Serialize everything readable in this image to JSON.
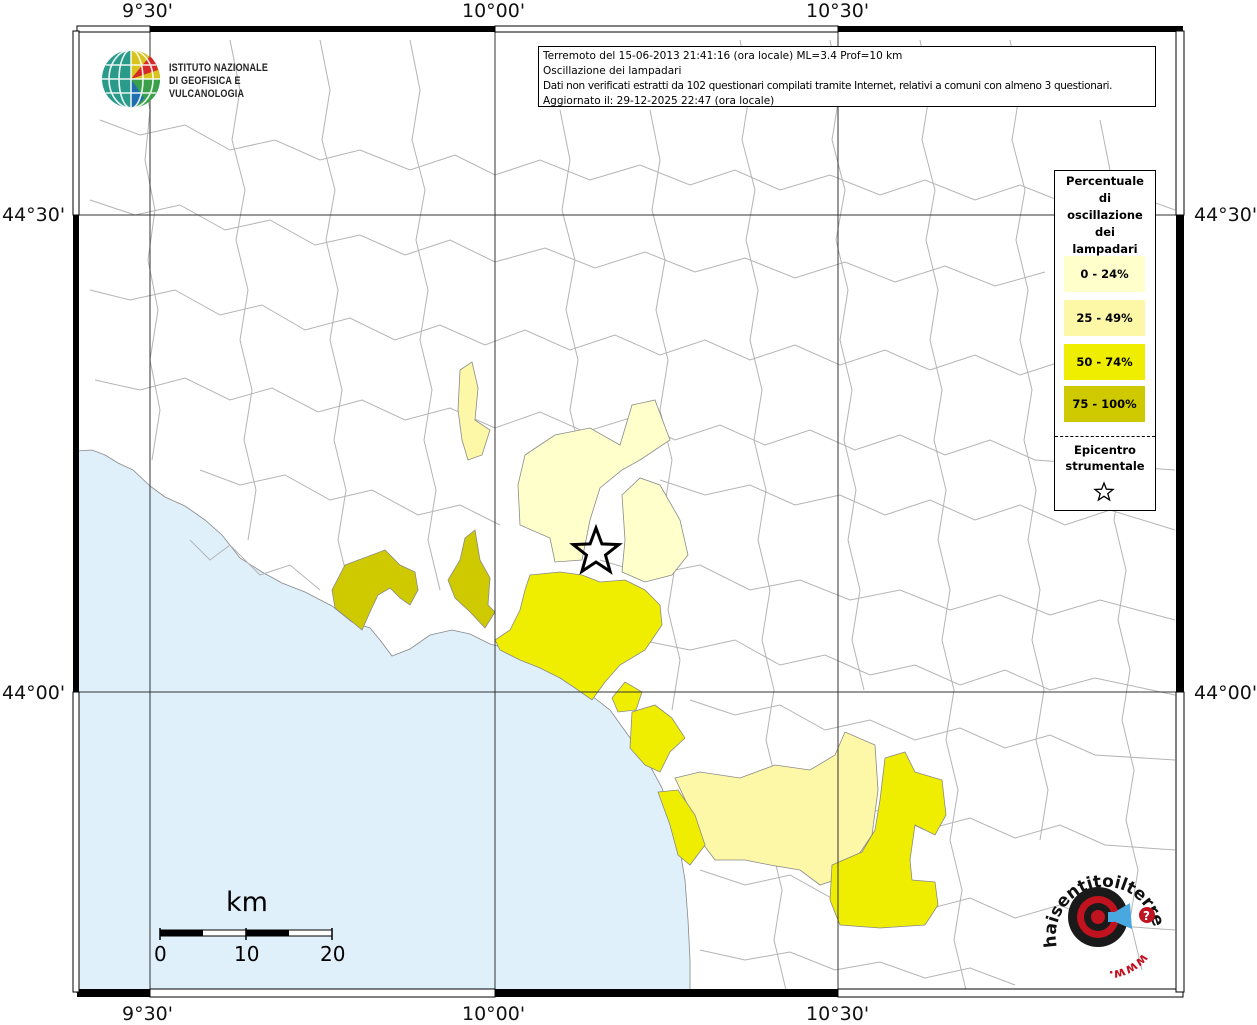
{
  "map": {
    "lon_labels": [
      "9°30'",
      "10°00'",
      "10°30'"
    ],
    "lat_labels": [
      "44°30'",
      "44°00'"
    ],
    "colors": {
      "sea": "#dff0fb",
      "land": "#ffffff",
      "borders": "#b4b4b4",
      "grid": "#333333",
      "class_0_24": "#ffffcc",
      "class_25_49": "#fdf7a8",
      "class_50_74": "#f0ee00",
      "class_75_100": "#cfc900"
    }
  },
  "info": {
    "line1": "Terremoto del 15-06-2013 21:41:16 (ora locale) ML=3.4 Prof=10 km",
    "line2": "Oscillazione dei lampadari",
    "line3": "Dati non verificati estratti da 102 questionari compilati tramite Internet, relativi a comuni con almeno 3 questionari.",
    "line4": "Aggiornato il: 29-12-2025 22:47 (ora locale)"
  },
  "logo": {
    "line1": "ISTITUTO NAZIONALE",
    "line2": "DI GEOFISICA E VULCANOLOGIA"
  },
  "legend": {
    "title_lines": [
      "Percentuale",
      "di",
      "oscillazione",
      "dei",
      "lampadari"
    ],
    "items": [
      {
        "label": "0 - 24%",
        "color": "#ffffcc"
      },
      {
        "label": "25 - 49%",
        "color": "#fdf7a8"
      },
      {
        "label": "50 - 74%",
        "color": "#f0ee00"
      },
      {
        "label": "75 - 100%",
        "color": "#cfc900"
      }
    ],
    "epicenter_lines": [
      "Epicentro",
      "strumentale"
    ],
    "star_icon": "star-outline-icon"
  },
  "scalebar": {
    "unit": "km",
    "ticks": [
      "0",
      "10",
      "20"
    ]
  },
  "hst_logo": {
    "text": "haisentitoilterremoto.it",
    "url_text": "www.",
    "icon": "target-megaphone-icon"
  }
}
